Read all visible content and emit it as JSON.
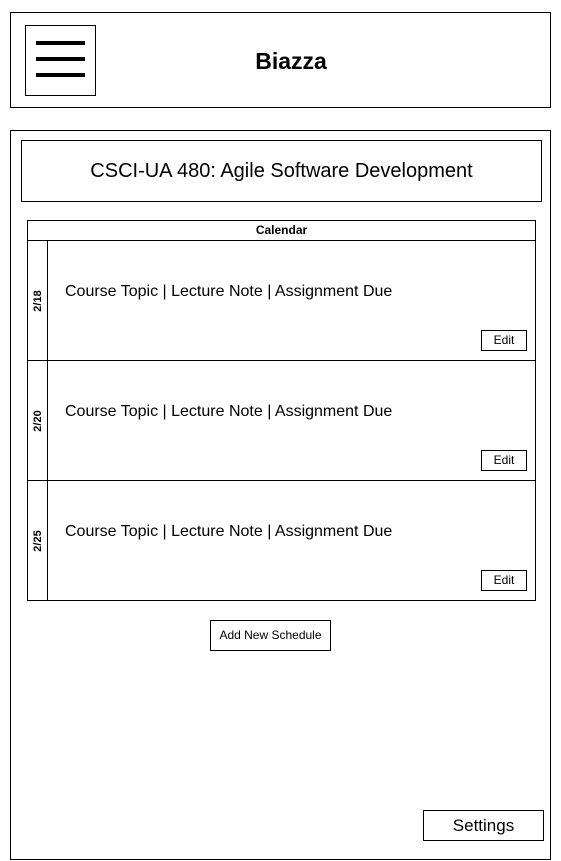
{
  "header": {
    "app_title": "Biazza",
    "menu_icon": "hamburger-menu-icon"
  },
  "course": {
    "title": "CSCI-UA 480: Agile Software Development"
  },
  "calendar": {
    "heading": "Calendar",
    "rows": [
      {
        "date": "2/18",
        "content": "Course Topic | Lecture Note | Assignment Due",
        "edit_label": "Edit"
      },
      {
        "date": "2/20",
        "content": "Course Topic | Lecture Note | Assignment Due",
        "edit_label": "Edit"
      },
      {
        "date": "2/25",
        "content": "Course Topic | Lecture Note | Assignment Due",
        "edit_label": "Edit"
      }
    ]
  },
  "actions": {
    "add_schedule_label": "Add New Schedule",
    "settings_label": "Settings"
  }
}
